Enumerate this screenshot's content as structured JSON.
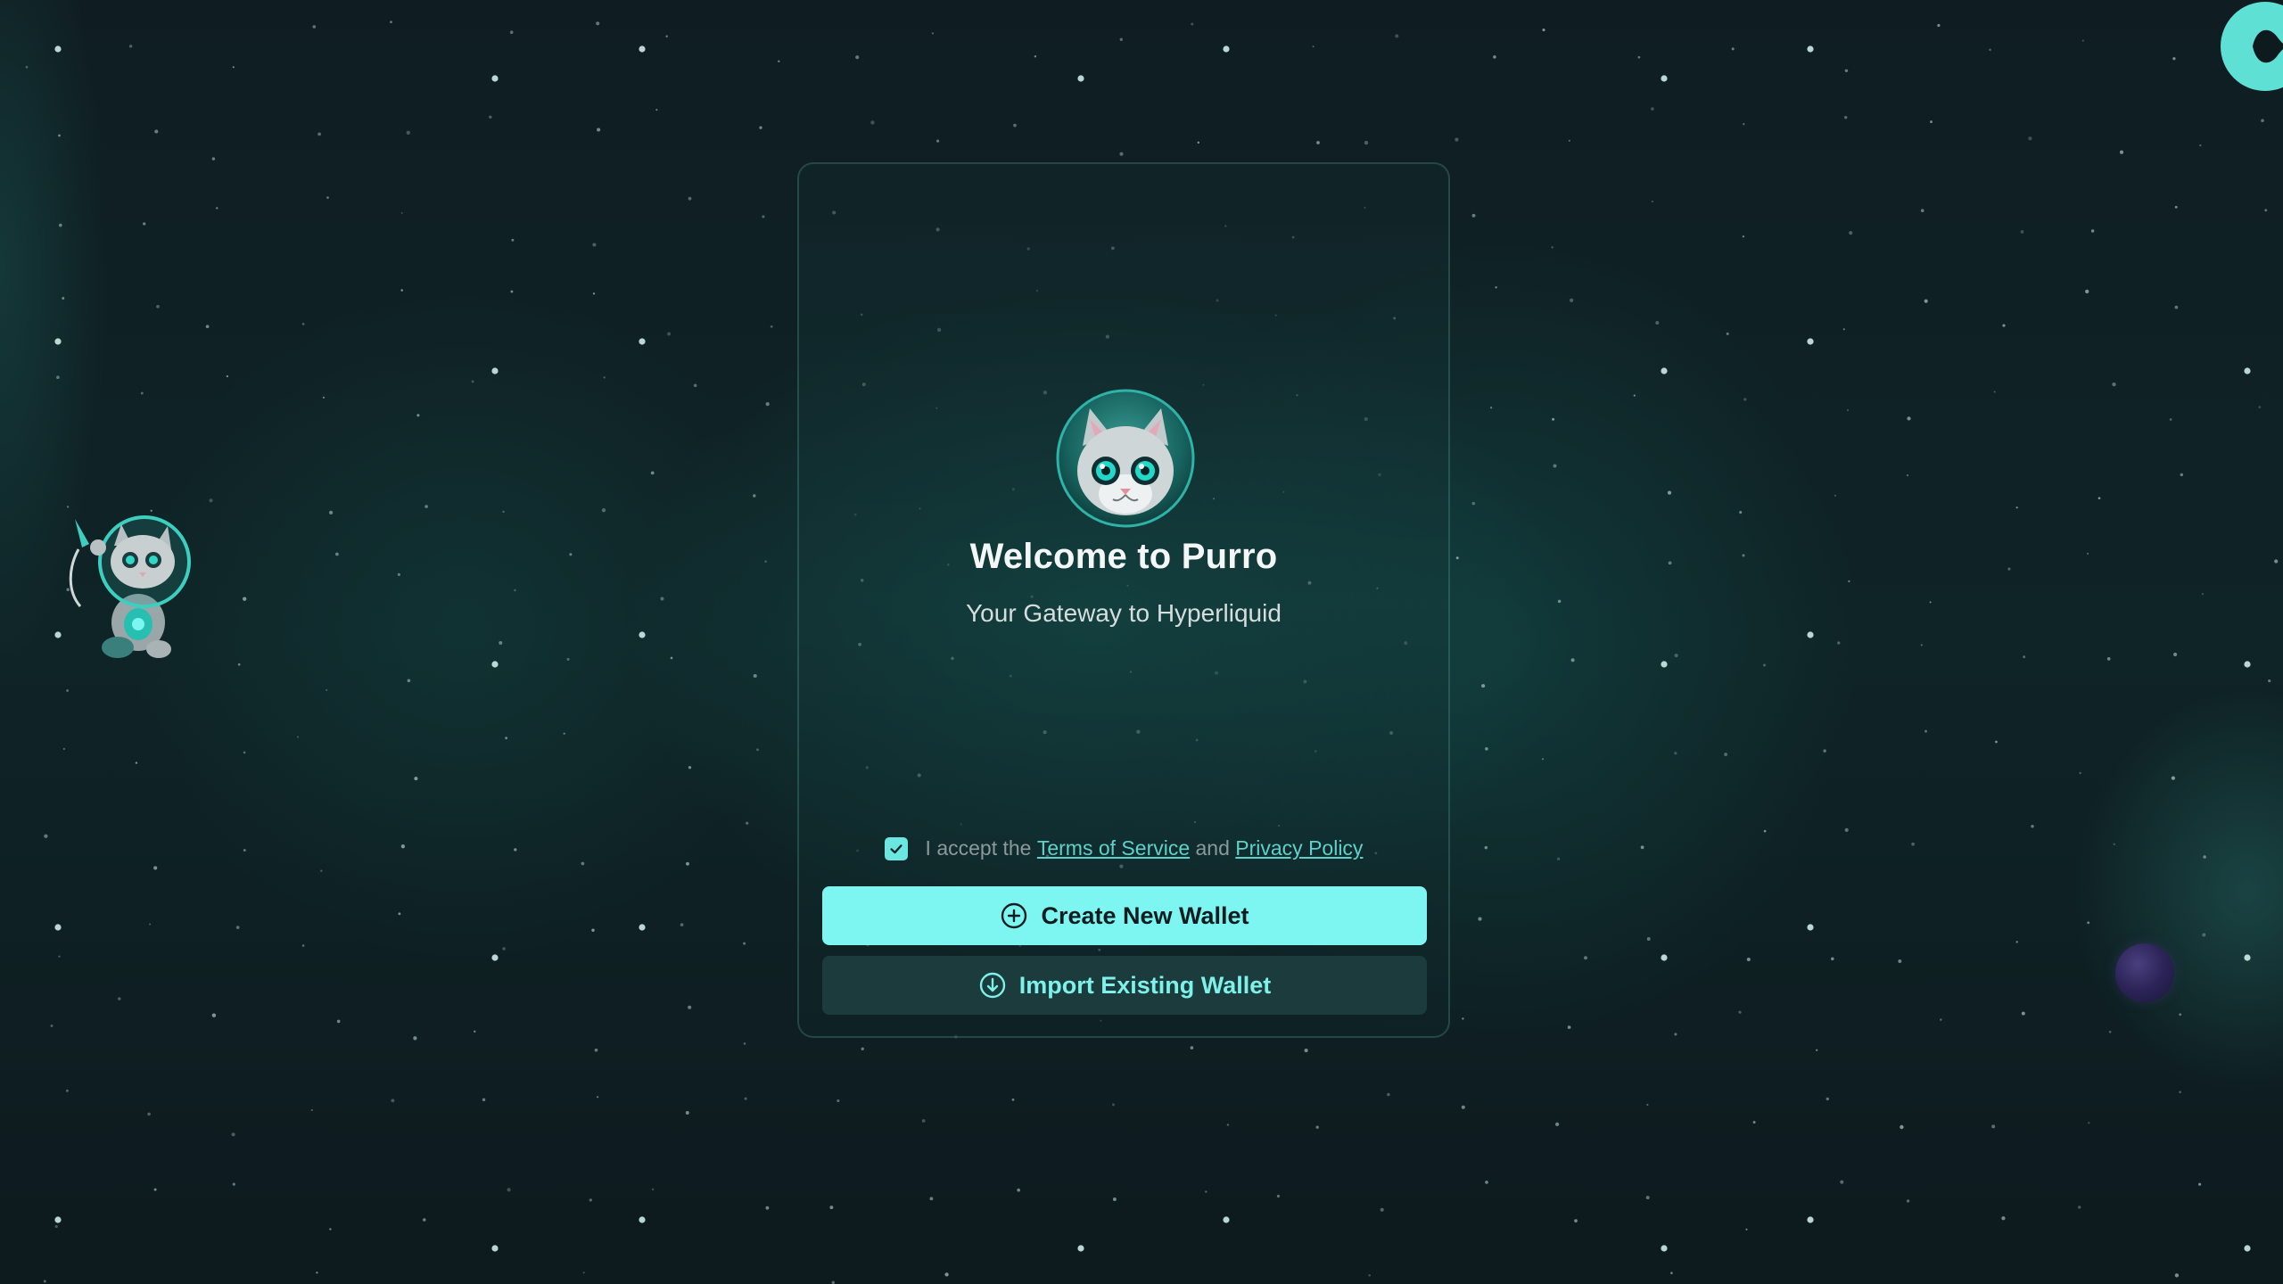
{
  "welcome": {
    "title": "Welcome to Purro",
    "subtitle": "Your Gateway to Hyperliquid"
  },
  "terms": {
    "checked": true,
    "prefix": "I accept the",
    "tos_link": "Terms of Service",
    "conjunction": "and",
    "privacy_link": "Privacy Policy"
  },
  "actions": {
    "create_label": "Create New Wallet",
    "create_icon": "plus-circle-icon",
    "import_label": "Import Existing Wallet",
    "import_icon": "arrow-down-circle-icon"
  },
  "decorations": {
    "logo_icon": "purro-cat-logo-icon",
    "astronaut_icon": "astronaut-cat-icon",
    "corner_icon": "hyperliquid-logo-icon",
    "planet_icon": "purple-planet-icon"
  },
  "colors": {
    "accent": "#7df6f2",
    "link": "#5fd1c9",
    "background": "#0d1a1e",
    "secondary_button": "#1b3b3c"
  }
}
